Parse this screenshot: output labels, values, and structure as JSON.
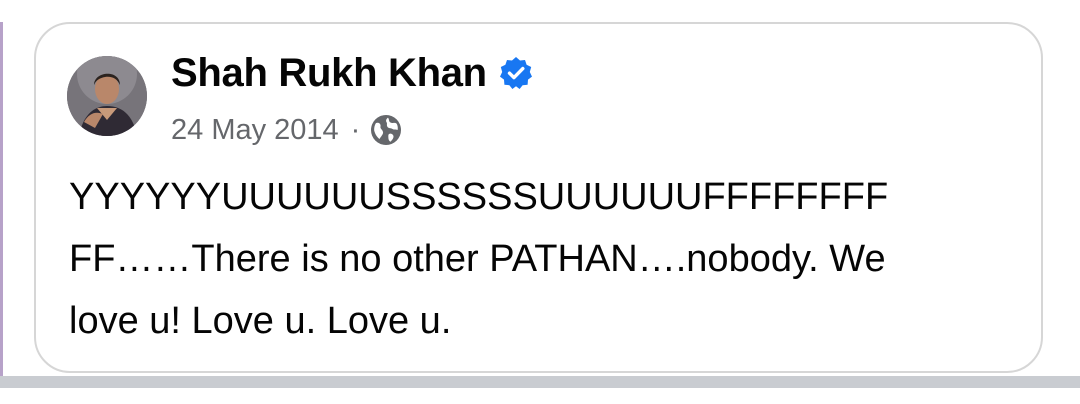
{
  "post": {
    "author": "Shah Rukh Khan",
    "verified": true,
    "date": "24 May 2014",
    "separator": "·",
    "audience_icon": "globe-icon",
    "avatar_icon": "profile-photo",
    "text_lines": [
      "YYYYYYUUUUUUSSSSSSUUUUUUFFFFFFFF",
      "FF……There is no other PATHAN….nobody. We",
      "love u! Love u. Love u."
    ]
  },
  "colors": {
    "verified_badge": "#1877f2",
    "meta_text": "#65676b",
    "body_text": "#050505",
    "card_border": "#d6d6d6",
    "divider": "#c9ccd1"
  }
}
